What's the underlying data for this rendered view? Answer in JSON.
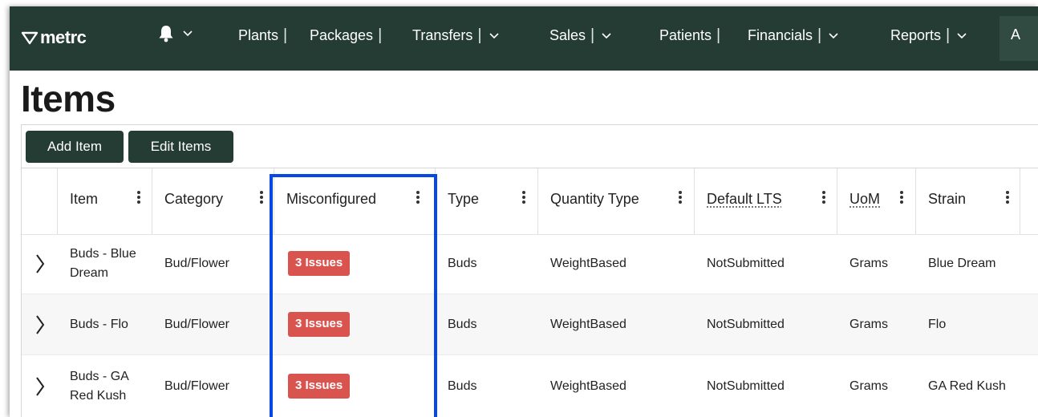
{
  "nav": {
    "logo": "metrc",
    "items": [
      {
        "label": "Plants",
        "dropdown": false
      },
      {
        "label": "Packages",
        "dropdown": false
      },
      {
        "label": "Transfers",
        "dropdown": true
      },
      {
        "label": "Sales",
        "dropdown": true
      },
      {
        "label": "Patients",
        "dropdown": false
      },
      {
        "label": "Financials",
        "dropdown": true
      },
      {
        "label": "Reports",
        "dropdown": true
      }
    ],
    "admin_partial": "A"
  },
  "page": {
    "title": "Items"
  },
  "toolbar": {
    "add_label": "Add Item",
    "edit_label": "Edit Items"
  },
  "table": {
    "columns": [
      "Item",
      "Category",
      "Misconfigured",
      "Type",
      "Quantity Type",
      "Default LTS",
      "UoM",
      "Strain"
    ],
    "rows": [
      {
        "item": "Buds - Blue Dream",
        "category": "Bud/Flower",
        "misconfigured": "3 Issues",
        "type": "Buds",
        "quantity_type": "WeightBased",
        "default_lts": "NotSubmitted",
        "uom": "Grams",
        "strain": "Blue Dream"
      },
      {
        "item": "Buds - Flo",
        "category": "Bud/Flower",
        "misconfigured": "3 Issues",
        "type": "Buds",
        "quantity_type": "WeightBased",
        "default_lts": "NotSubmitted",
        "uom": "Grams",
        "strain": "Flo"
      },
      {
        "item": "Buds - GA Red Kush",
        "category": "Bud/Flower",
        "misconfigured": "3 Issues",
        "type": "Buds",
        "quantity_type": "WeightBased",
        "default_lts": "NotSubmitted",
        "uom": "Grams",
        "strain": "GA Red Kush"
      }
    ]
  },
  "colors": {
    "nav_bg": "#253c34",
    "badge_bg": "#d9534f",
    "highlight": "#0747e6"
  }
}
